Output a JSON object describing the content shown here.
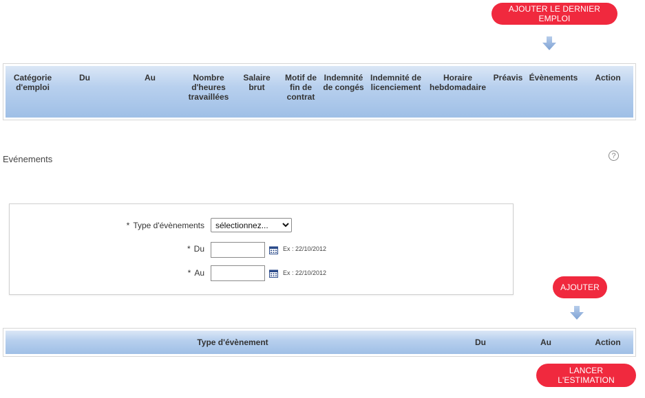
{
  "buttons": {
    "add_last_job": "AJOUTER LE DERNIER EMPLOI",
    "add_event": "AJOUTER",
    "launch_estimate": "LANCER L'ESTIMATION"
  },
  "jobs_table": {
    "headers": [
      "Catégorie d'emploi",
      "Du",
      "Au",
      "Nombre d'heures travaillées",
      "Salaire brut",
      "Motif de fin de contrat",
      "Indemnité de congés",
      "Indemnité de licenciement",
      "Horaire hebdomadaire",
      "Préavis",
      "Évènements",
      "Action"
    ]
  },
  "events_section": {
    "title": "Evénements",
    "help_symbol": "?"
  },
  "form": {
    "required_marker": "*",
    "type_label": "Type d'évènements",
    "type_selected": "sélectionnez...",
    "du_label": "Du",
    "au_label": "Au",
    "du_value": "",
    "au_value": "",
    "date_example": "Ex : 22/10/2012"
  },
  "events_table": {
    "headers": [
      "Type d'évènement",
      "Du",
      "Au",
      "Action"
    ]
  },
  "colors": {
    "accent": "#f0293e",
    "header_gradient_top": "#dbe7f6",
    "header_gradient_bottom": "#9fbfe6",
    "arrow": "#8fb0dc",
    "calendar_icon": "#2a4a8a"
  },
  "icons": {
    "arrow": "down-arrow-icon",
    "help": "help-icon",
    "calendar": "calendar-icon"
  }
}
